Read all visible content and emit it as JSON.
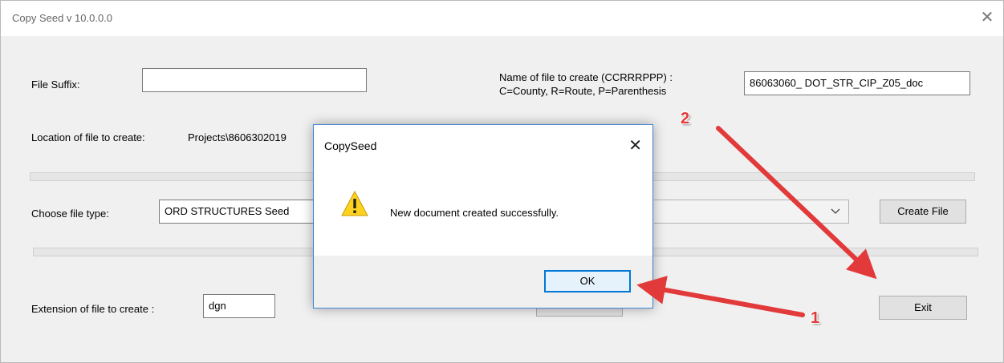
{
  "window": {
    "title": "Copy Seed v 10.0.0.0",
    "close_glyph": "✕"
  },
  "form": {
    "file_suffix_label": "File Suffix:",
    "file_suffix_value": "",
    "name_label_line1": "Name of file to create (CCRRRPPP) :",
    "name_label_line2": "C=County, R=Route, P=Parenthesis",
    "name_value": "86063060_ DOT_STR_CIP_Z05_doc",
    "location_label": "Location of file to create:",
    "location_value": "Projects\\8606302019",
    "choose_type_label": "Choose file type:",
    "file_type_value": "ORD STRUCTURES Seed",
    "create_file_button": "Create File",
    "extension_label": "Extension of file to create :",
    "extension_value": "dgn",
    "exit_button": "Exit"
  },
  "dialog": {
    "title": "CopySeed",
    "close_glyph": "✕",
    "message": "New document created successfully.",
    "ok_button": "OK",
    "icon": "warning-icon"
  },
  "annotations": {
    "label_1": "1",
    "label_2": "2",
    "arrow_color": "#e23a3a"
  }
}
